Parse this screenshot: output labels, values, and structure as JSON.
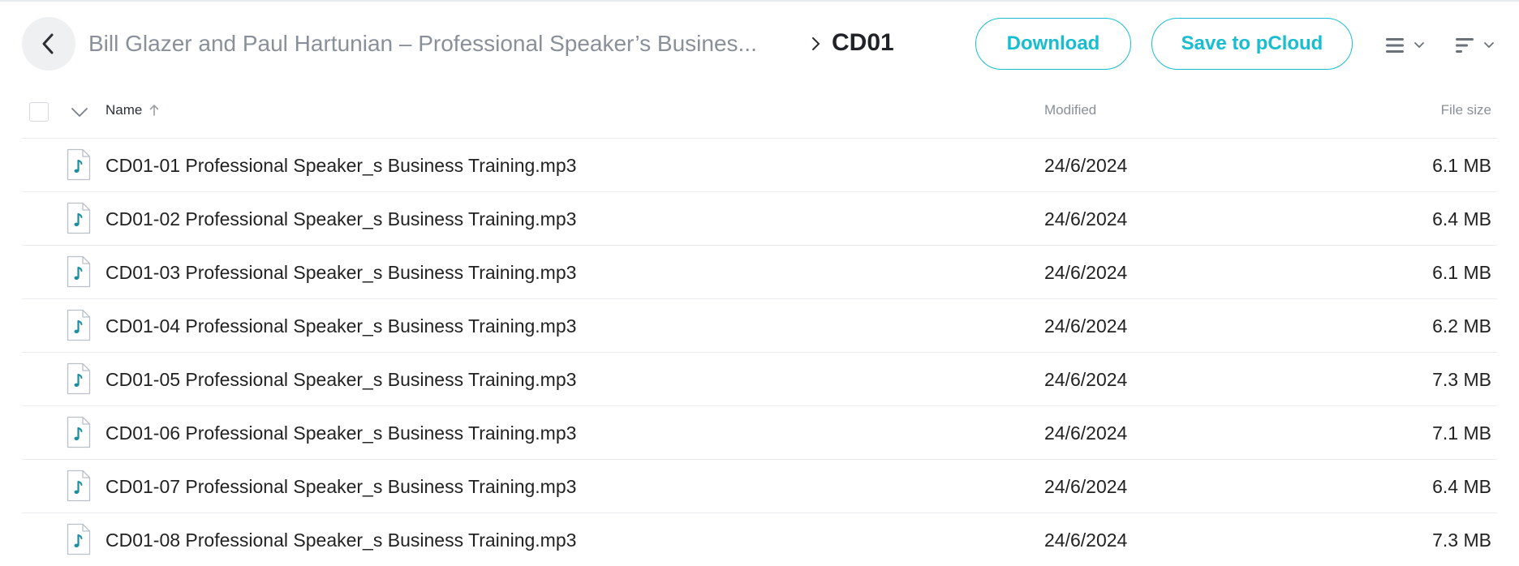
{
  "breadcrumb": {
    "parent": "Bill Glazer and Paul Hartunian – Professional Speaker’s Busines...",
    "current": "CD01"
  },
  "actions": {
    "download_label": "Download",
    "save_label": "Save to pCloud"
  },
  "table": {
    "columns": {
      "name": "Name",
      "modified": "Modified",
      "size": "File size"
    },
    "rows": [
      {
        "name": "CD01-01 Professional Speaker_s Business Training.mp3",
        "modified": "24/6/2024",
        "size": "6.1 MB"
      },
      {
        "name": "CD01-02 Professional Speaker_s Business Training.mp3",
        "modified": "24/6/2024",
        "size": "6.4 MB"
      },
      {
        "name": "CD01-03 Professional Speaker_s Business Training.mp3",
        "modified": "24/6/2024",
        "size": "6.1 MB"
      },
      {
        "name": "CD01-04 Professional Speaker_s Business Training.mp3",
        "modified": "24/6/2024",
        "size": "6.2 MB"
      },
      {
        "name": "CD01-05 Professional Speaker_s Business Training.mp3",
        "modified": "24/6/2024",
        "size": "7.3 MB"
      },
      {
        "name": "CD01-06 Professional Speaker_s Business Training.mp3",
        "modified": "24/6/2024",
        "size": "7.1 MB"
      },
      {
        "name": "CD01-07 Professional Speaker_s Business Training.mp3",
        "modified": "24/6/2024",
        "size": "6.4 MB"
      },
      {
        "name": "CD01-08 Professional Speaker_s Business Training.mp3",
        "modified": "24/6/2024",
        "size": "7.3 MB"
      }
    ]
  },
  "icons": {
    "back": "arrow-left-icon",
    "separator": "chevron-right-icon",
    "view": "list-view-icon",
    "sort": "sort-icon",
    "file": "audio-file-icon"
  },
  "colors": {
    "accent": "#17bed0",
    "muted_text": "#8a9099",
    "audio_icon": "#1a8fa0"
  }
}
